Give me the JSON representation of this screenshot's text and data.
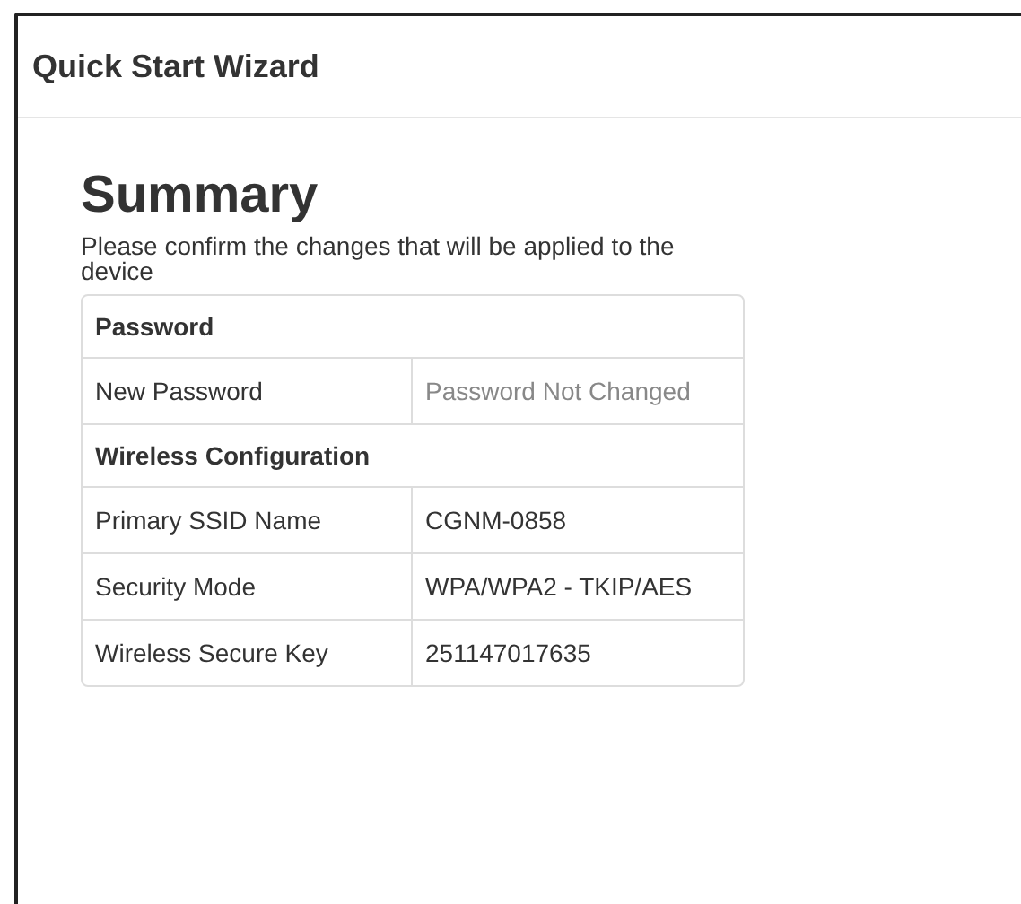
{
  "dialog": {
    "title": "Quick Start Wizard"
  },
  "summary": {
    "heading": "Summary",
    "description": "Please confirm the changes that will be applied to the device",
    "sections": [
      {
        "title": "Password",
        "rows": [
          {
            "label": "New Password",
            "value": "Password Not Changed",
            "muted": true
          }
        ]
      },
      {
        "title": "Wireless Configuration",
        "rows": [
          {
            "label": "Primary SSID Name",
            "value": "CGNM-0858",
            "muted": false
          },
          {
            "label": "Security Mode",
            "value": "WPA/WPA2 - TKIP/AES",
            "muted": false
          },
          {
            "label": "Wireless Secure Key",
            "value": "251147017635",
            "muted": false
          }
        ]
      }
    ]
  }
}
